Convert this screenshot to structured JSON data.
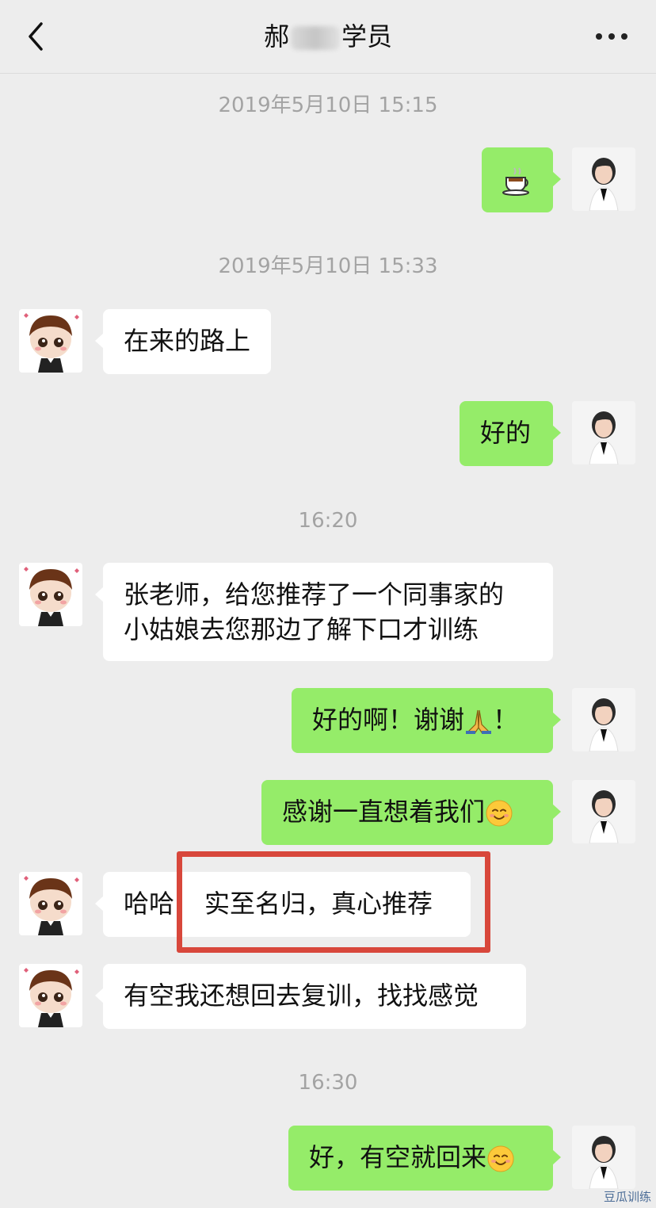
{
  "header": {
    "title_prefix": "郝",
    "title_suffix": "学员",
    "back_icon": "chevron-left-icon",
    "more_icon": "more-dots-icon"
  },
  "timestamps": [
    "2019年5月10日 15:15",
    "2019年5月10日 15:33",
    "16:20",
    "16:30"
  ],
  "messages": [
    {
      "side": "out",
      "text": "",
      "emoji": "tea-cup-emoji"
    },
    {
      "side": "in",
      "text": "在来的路上"
    },
    {
      "side": "out",
      "text": "好的"
    },
    {
      "side": "in",
      "lines": [
        "张老师，给您推荐了一个同事家的",
        "小姑娘去您那边了解下口才训练"
      ]
    },
    {
      "side": "out",
      "text": "好的啊！谢谢",
      "text_after": "！",
      "emoji": "folded-hands-emoji"
    },
    {
      "side": "out",
      "text": "感谢一直想着我们",
      "emoji": "smiling-face-emoji"
    },
    {
      "side": "in",
      "text_a": "哈哈",
      "text_b": "实至名归，真心推荐",
      "highlighted": true
    },
    {
      "side": "in",
      "text": "有空我还想回去复训，找找感觉"
    },
    {
      "side": "out",
      "text": "好，有空就回来",
      "emoji": "smiling-face-emoji"
    }
  ],
  "colors": {
    "background": "#ededed",
    "bubble_out": "#95ec69",
    "bubble_in": "#ffffff",
    "highlight": "#d8473b",
    "timestamp": "#a3a3a3"
  },
  "watermark": "豆瓜训练"
}
